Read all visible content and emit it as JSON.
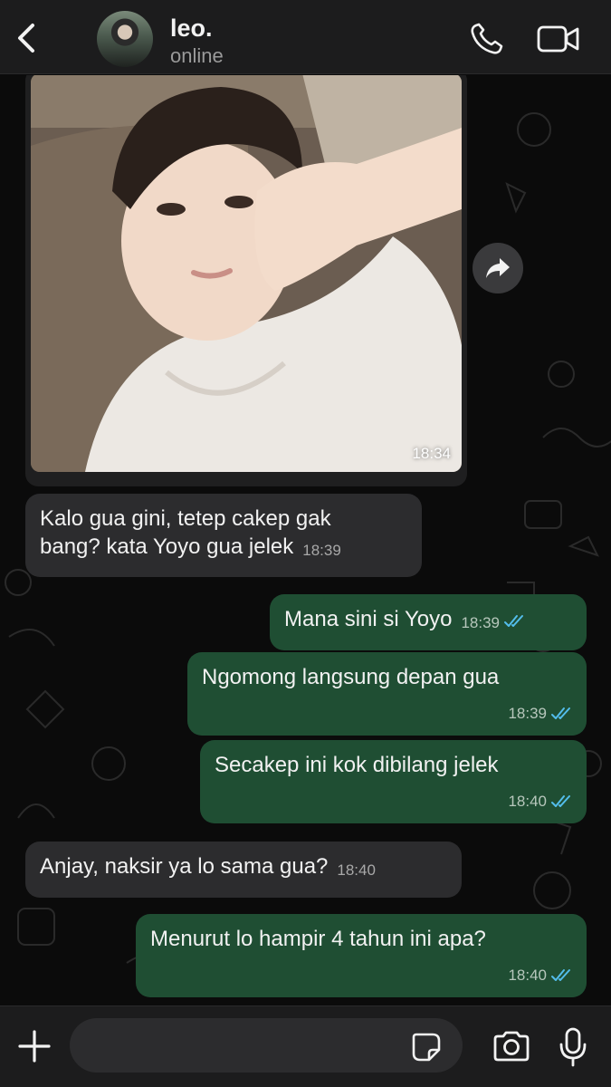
{
  "header": {
    "contact_name": "leo.",
    "status": "online"
  },
  "messages": [
    {
      "type": "image",
      "direction": "incoming",
      "time": "18:34"
    },
    {
      "type": "text",
      "direction": "incoming",
      "lines": [
        "Kalo gua gini, tetep cakep gak",
        "bang? kata Yoyo gua jelek"
      ],
      "time": "18:39"
    },
    {
      "type": "text",
      "direction": "outgoing",
      "text": "Mana sini si Yoyo",
      "time": "18:39",
      "status": "read"
    },
    {
      "type": "text",
      "direction": "outgoing",
      "text": "Ngomong langsung depan gua",
      "time": "18:39",
      "status": "read"
    },
    {
      "type": "text",
      "direction": "outgoing",
      "text": "Secakep ini kok dibilang jelek",
      "time": "18:40",
      "status": "read"
    },
    {
      "type": "text",
      "direction": "incoming",
      "text": "Anjay, naksir ya lo sama gua?",
      "time": "18:40"
    },
    {
      "type": "text",
      "direction": "outgoing",
      "text": "Menurut lo hampir 4 tahun ini apa?",
      "time": "18:40",
      "status": "read"
    }
  ],
  "composer": {
    "placeholder": ""
  },
  "icons": {
    "back": "chevron-left-icon",
    "call": "phone-icon",
    "video": "video-camera-icon",
    "forward": "forward-arrow-icon",
    "add": "plus-icon",
    "sticker": "sticker-icon",
    "camera": "camera-icon",
    "mic": "microphone-icon",
    "read_receipt": "double-check-icon"
  },
  "colors": {
    "incoming_bubble": "#2c2c2e",
    "outgoing_bubble": "#1f4e33",
    "read_ticks": "#53bdeb",
    "header_bg": "#1c1c1d"
  }
}
